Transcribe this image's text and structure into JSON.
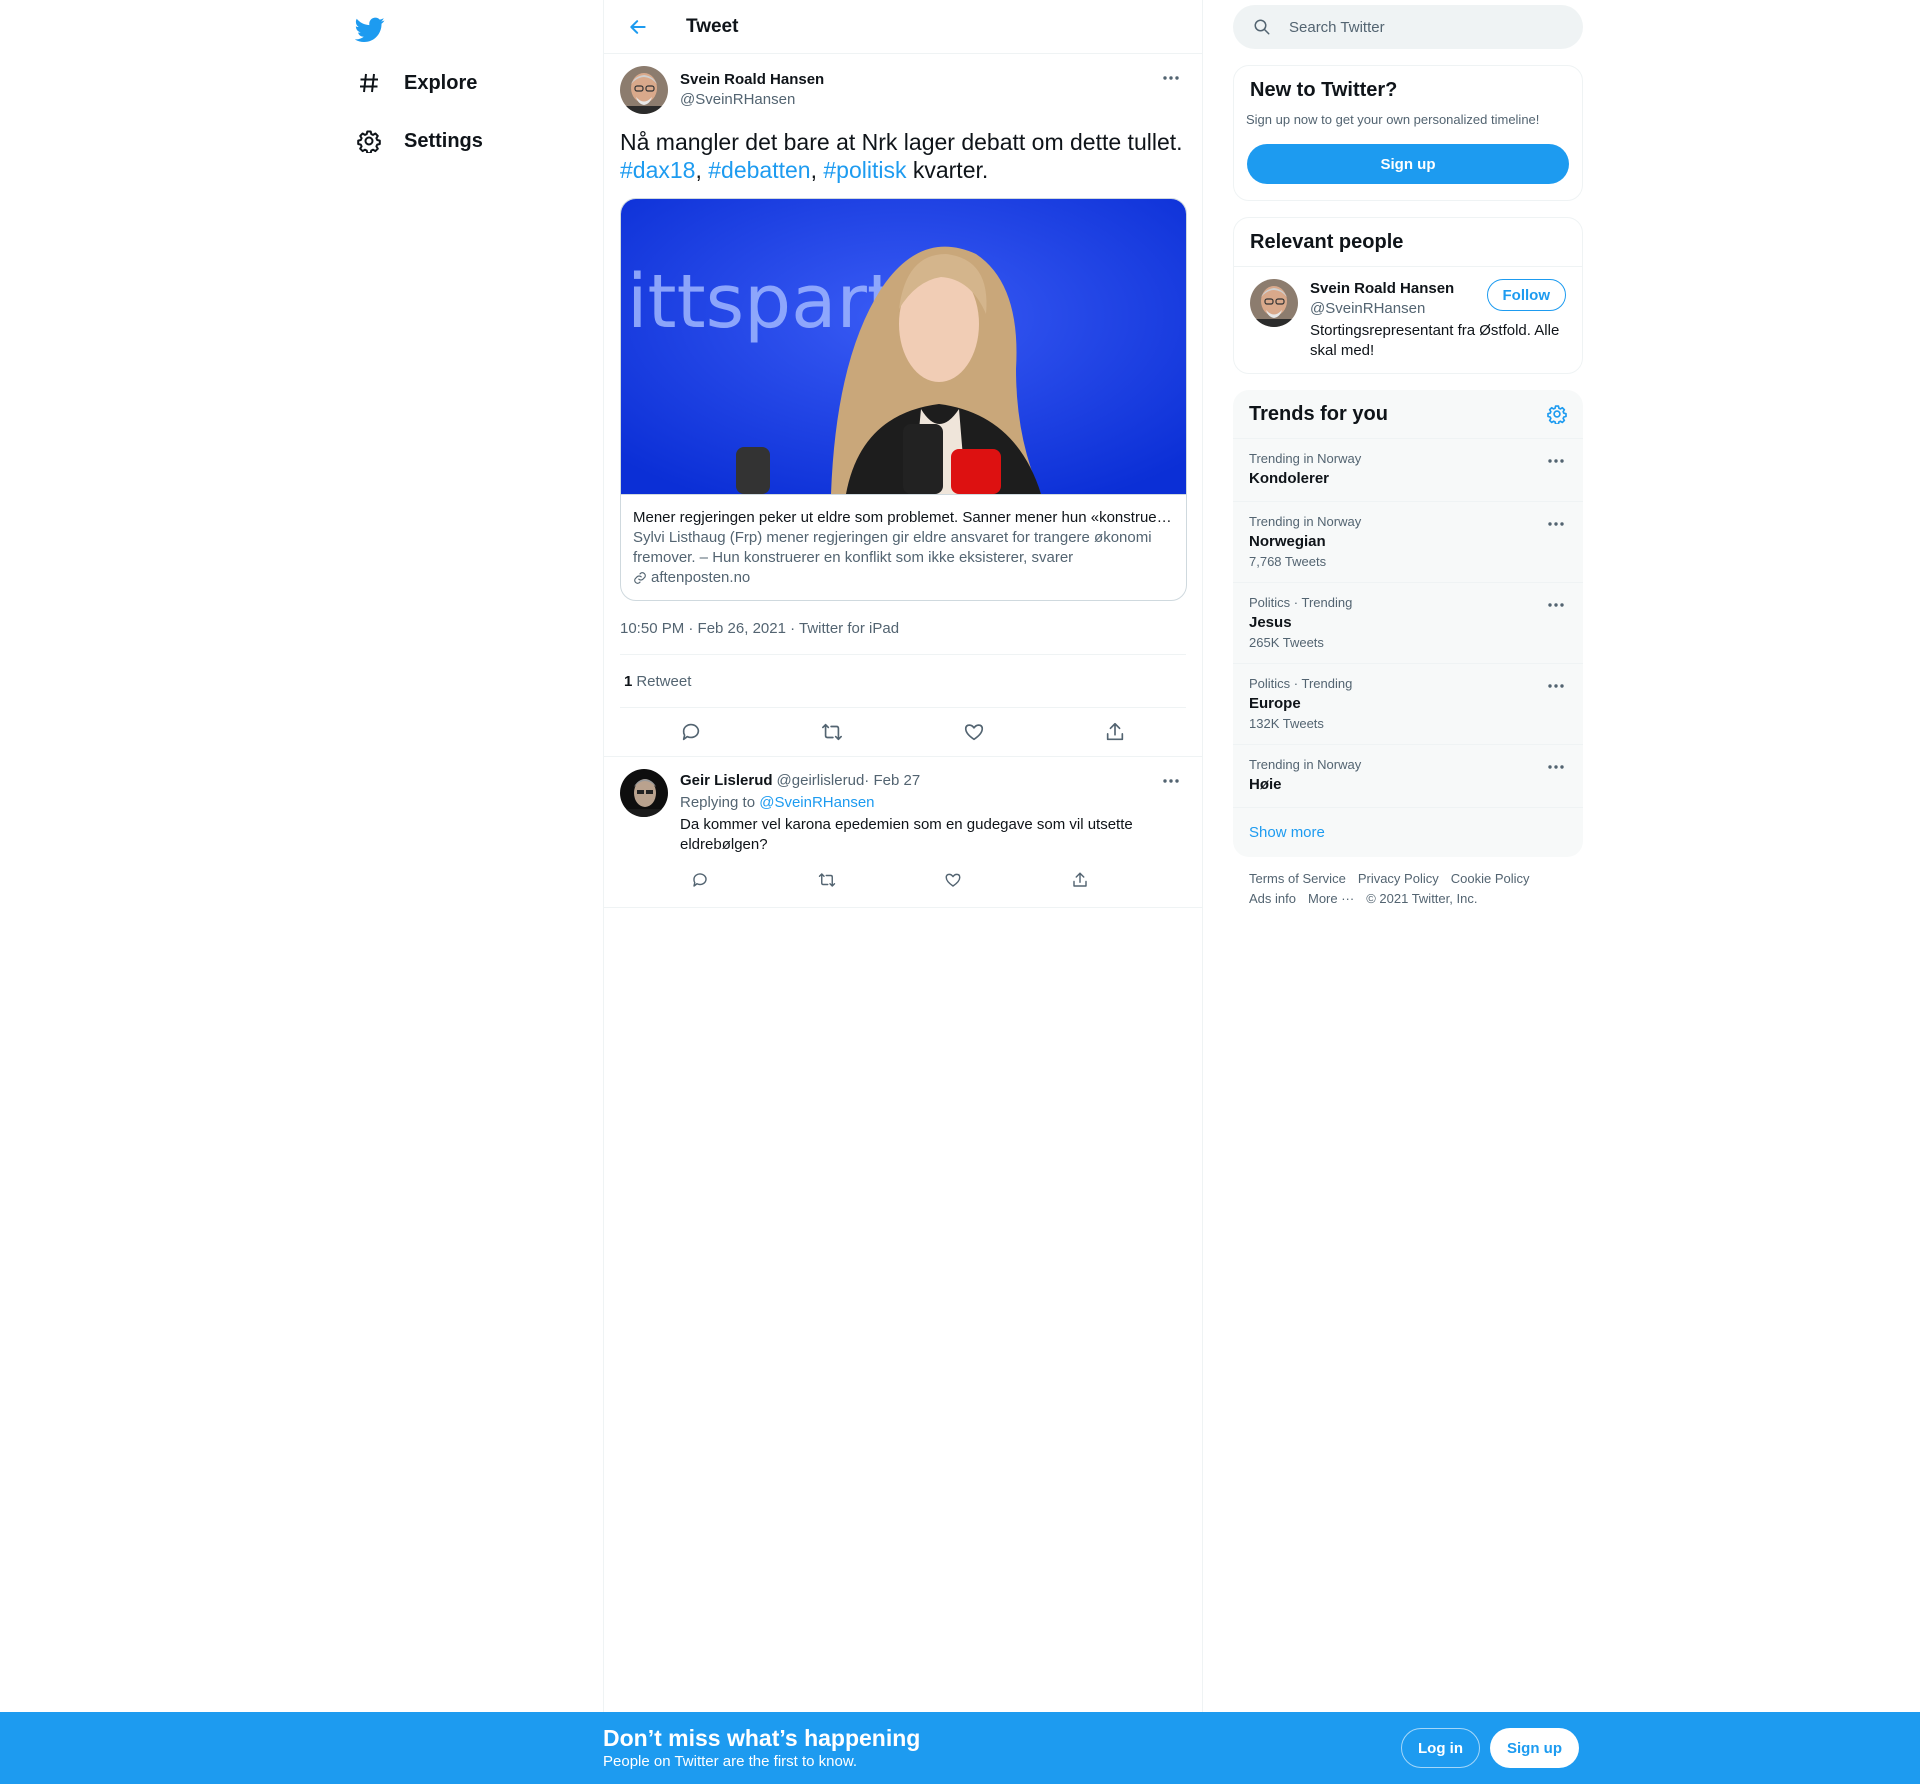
{
  "colors": {
    "accent": "#1d9bf0",
    "text": "#0f1419",
    "muted": "#536471",
    "border": "#eff3f4"
  },
  "nav": {
    "logo_icon": "twitter-bird-icon",
    "items": [
      {
        "label": "Explore",
        "icon": "hashtag-icon"
      },
      {
        "label": "Settings",
        "icon": "gear-icon"
      }
    ]
  },
  "header": {
    "title": "Tweet",
    "back_icon": "arrow-left-icon"
  },
  "tweet": {
    "author_name": "Svein Roald Hansen",
    "author_handle": "@SveinRHansen",
    "text_part1": "Nå mangler det bare at Nrk lager debatt om dette tullet.",
    "hashtags": [
      "#dax18",
      "#debatten",
      "#politisk"
    ],
    "sep1": ", ",
    "sep2": ", ",
    "text_part2": " kvarter.",
    "card": {
      "image_text": "ittspart",
      "title": "Mener regjeringen peker ut eldre som problemet. Sanner mener hun «konstruerer en konflikt som ikke eksisterer»",
      "description": "Sylvi Listhaug (Frp) mener regjeringen gir eldre ansvaret for trangere økonomi fremover. – Hun konstruerer en konflikt som ikke eksisterer, svarer finansministeren.",
      "domain": "aftenposten.no"
    },
    "meta": "10:50 PM · Feb 26, 2021 · Twitter for iPad",
    "retweet_count": "1",
    "retweet_label": "Retweet"
  },
  "reply": {
    "author_name": "Geir Lislerud",
    "author_handle": "@geirlislerud",
    "date": " · Feb 27",
    "replying_prefix": "Replying to ",
    "replying_to": "@SveinRHansen",
    "text": "Da kommer vel karona epedemien som en gudegave som vil utsette eldrebølgen?"
  },
  "search": {
    "placeholder": "Search Twitter"
  },
  "new_to_twitter": {
    "title": "New to Twitter?",
    "description": "Sign up now to get your own personalized timeline!",
    "button": "Sign up"
  },
  "relevant_people": {
    "title": "Relevant people",
    "name": "Svein Roald Hansen",
    "handle": "@SveinRHansen",
    "follow": "Follow",
    "bio": "Stortingsrepresentant fra Østfold. Alle skal med!"
  },
  "trends": {
    "title": "Trends for you",
    "items": [
      {
        "context": "Trending in Norway",
        "name": "Kondolerer",
        "count": ""
      },
      {
        "context": "Trending in Norway",
        "name": "Norwegian",
        "count": "7,768 Tweets"
      },
      {
        "context": "Politics · Trending",
        "name": "Jesus",
        "count": "265K Tweets"
      },
      {
        "context": "Politics · Trending",
        "name": "Europe",
        "count": "132K Tweets"
      },
      {
        "context": "Trending in Norway",
        "name": "Høie",
        "count": ""
      }
    ],
    "show_more": "Show more"
  },
  "footer": {
    "links": [
      "Terms of Service",
      "Privacy Policy",
      "Cookie Policy",
      "Ads info",
      "More ···",
      "© 2021 Twitter, Inc."
    ]
  },
  "bottom_bar": {
    "title": "Don’t miss what’s happening",
    "subtitle": "People on Twitter are the first to know.",
    "login": "Log in",
    "signup": "Sign up"
  }
}
